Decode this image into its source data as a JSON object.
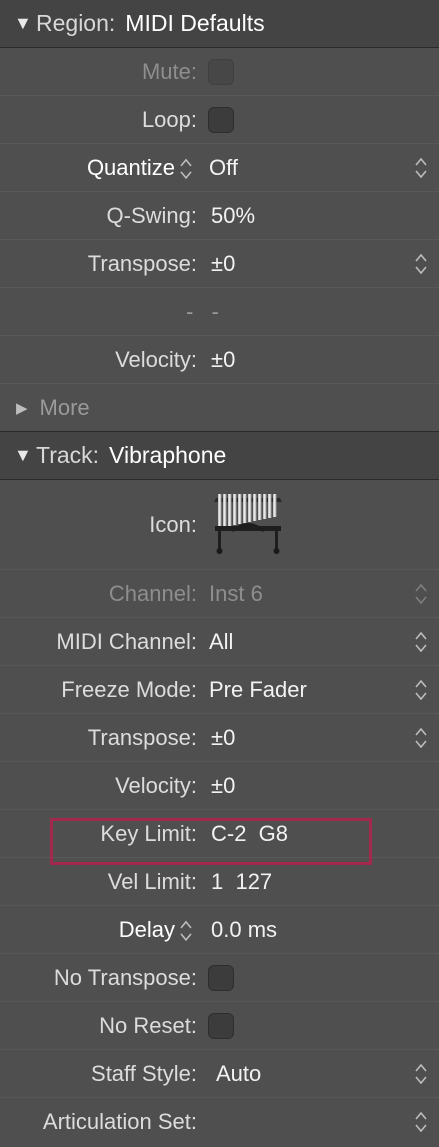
{
  "region": {
    "header_label": "Region:",
    "header_value": "MIDI Defaults",
    "rows": {
      "mute_label": "Mute:",
      "loop_label": "Loop:",
      "quantize_label": "Quantize",
      "quantize_value": "Off",
      "qswing_label": "Q-Swing:",
      "qswing_value": "50%",
      "transpose_label": "Transpose:",
      "transpose_value": "±0",
      "placeholder": "- -",
      "velocity_label": "Velocity:",
      "velocity_value": "±0"
    },
    "more_label": "More"
  },
  "track": {
    "header_label": "Track:",
    "header_value": "Vibraphone",
    "rows": {
      "icon_label": "Icon:",
      "icon_name": "vibraphone-icon",
      "channel_label": "Channel:",
      "channel_value": "Inst 6",
      "midi_channel_label": "MIDI Channel:",
      "midi_channel_value": "All",
      "freeze_label": "Freeze Mode:",
      "freeze_value": "Pre Fader",
      "transpose_label": "Transpose:",
      "transpose_value": "±0",
      "velocity_label": "Velocity:",
      "velocity_value": "±0",
      "key_limit_label": "Key Limit:",
      "key_limit_value": "C-2  G8",
      "vel_limit_label": "Vel Limit:",
      "vel_limit_value": "1  127",
      "delay_label": "Delay",
      "delay_value": "0.0 ms",
      "no_transpose_label": "No Transpose:",
      "no_reset_label": "No Reset:",
      "staff_style_label": "Staff Style:",
      "staff_style_value": "Auto",
      "articulation_label": "Articulation Set:"
    }
  },
  "colors": {
    "panel_bg": "#4f4f4f",
    "header_bg": "#444444",
    "highlight": "#a3284e"
  }
}
